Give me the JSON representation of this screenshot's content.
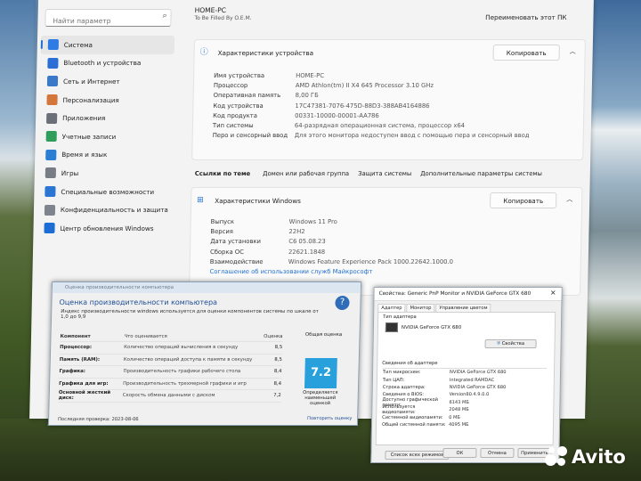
{
  "colors": {
    "accent": "#1f6fd1",
    "score": "#28a0dc",
    "wei_heading": "#1e4e94"
  },
  "sidebar": {
    "search_placeholder": "Найти параметр",
    "items": [
      {
        "label": "Система",
        "icon": "display-icon",
        "color": "#2f7be5",
        "active": true
      },
      {
        "label": "Bluetooth и устройства",
        "icon": "bluetooth-icon",
        "color": "#2b6fd6"
      },
      {
        "label": "Сеть и Интернет",
        "icon": "wifi-icon",
        "color": "#3a78c9"
      },
      {
        "label": "Персонализация",
        "icon": "brush-icon",
        "color": "#d4763c"
      },
      {
        "label": "Приложения",
        "icon": "apps-icon",
        "color": "#6b6f78"
      },
      {
        "label": "Учетные записи",
        "icon": "person-icon",
        "color": "#2f9e5b"
      },
      {
        "label": "Время и язык",
        "icon": "globe-clock-icon",
        "color": "#2a7fd4"
      },
      {
        "label": "Игры",
        "icon": "gamepad-icon",
        "color": "#777c85"
      },
      {
        "label": "Специальные возможности",
        "icon": "accessibility-icon",
        "color": "#2a76d2"
      },
      {
        "label": "Конфиденциальность и защита",
        "icon": "shield-icon",
        "color": "#7d848d"
      },
      {
        "label": "Центр обновления Windows",
        "icon": "refresh-icon",
        "color": "#1c6ed4"
      }
    ]
  },
  "header": {
    "pc_name": "HOME-PC",
    "pc_subtitle": "To Be Filled By O.E.M.",
    "rename_label": "Переименовать этот ПК"
  },
  "device_specs": {
    "title": "Характеристики устройства",
    "copy_label": "Копировать",
    "rows": [
      {
        "k": "Имя устройства",
        "v": "HOME-PC"
      },
      {
        "k": "Процессор",
        "v": "AMD Athlon(tm) II X4 645 Processor   3.10 GHz"
      },
      {
        "k": "Оперативная память",
        "v": "8,00 ГБ"
      },
      {
        "k": "Код устройства",
        "v": "17C47381-7076-475D-88D3-388AB4164886"
      },
      {
        "k": "Код продукта",
        "v": "00331-10000-00001-AA786"
      },
      {
        "k": "Тип системы",
        "v": "64-разрядная операционная система, процессор x64"
      },
      {
        "k": "Перо и сенсорный ввод",
        "v": "Для этого монитора недоступен ввод с помощью пера и сенсорный ввод"
      }
    ]
  },
  "related_links": {
    "items": [
      "Ссылки по теме",
      "Домен или рабочая группа",
      "Защита системы",
      "Дополнительные параметры системы"
    ]
  },
  "windows_specs": {
    "title": "Характеристики Windows",
    "copy_label": "Копировать",
    "rows": [
      {
        "k": "Выпуск",
        "v": "Windows 11 Pro"
      },
      {
        "k": "Версия",
        "v": "22H2"
      },
      {
        "k": "Дата установки",
        "v": "С6 05.08.23"
      },
      {
        "k": "Сборка ОС",
        "v": "22621.1848"
      },
      {
        "k": "Взаимодействие",
        "v": "Windows Feature Experience Pack 1000.22642.1000.0"
      },
      {
        "k": "Соглашение об использовании служб Майкрософт",
        "v": ""
      }
    ]
  },
  "wei": {
    "window_title": "Оценка производительности компьютера",
    "heading": "Оценка производительности компьютера",
    "description": "Индекс производительности windows используется для оценки компонентов системы по шкале от 1,0 до 9,9",
    "help": "?",
    "header": {
      "component": "Компонент",
      "rated": "Что оценивается",
      "score": "Оценка",
      "base": "Общая оценка"
    },
    "rows": [
      {
        "component": "Процессор:",
        "rated": "Количество операций вычисления в секунду",
        "score": "8,5"
      },
      {
        "component": "Память (RAM):",
        "rated": "Количество операций доступа к памяти в секунду",
        "score": "8,5"
      },
      {
        "component": "Графика:",
        "rated": "Производительность графики рабочего стола",
        "score": "8,4"
      },
      {
        "component": "Графика для игр:",
        "rated": "Производительность трехмерной графики и игр",
        "score": "8,4"
      },
      {
        "component": "Основной жесткий диск:",
        "rated": "Скорость обмена данными с диском",
        "score": "7,2"
      }
    ],
    "base_score": "7.2",
    "base_note": "Определяется наименьшей оценкой",
    "last_check": "Последняя проверка:  2023-08-06",
    "rerun": "Повторить оценку"
  },
  "display_props": {
    "title": "Свойства: Generic PnP Monitor и NVIDIA GeForce GTX 680",
    "close": "×",
    "tabs": [
      "Адаптер",
      "Монитор",
      "Управление цветом"
    ],
    "adapter_type_label": "Тип адаптера",
    "adapter_name": "NVIDIA GeForce GTX 680",
    "properties_button": "Свойства",
    "info_label": "Сведения об адаптере",
    "info_rows": [
      {
        "k": "Тип микросхем:",
        "v": "NVIDIA GeForce GTX 680"
      },
      {
        "k": "Тип ЦАП:",
        "v": "Integrated RAMDAC"
      },
      {
        "k": "Строка адаптера:",
        "v": "NVIDIA GeForce GTX 680"
      },
      {
        "k": "Сведения о BIOS:",
        "v": "Version80.4.9.0.0"
      },
      {
        "k": "Доступно графической памяти:",
        "v": "6143 МБ"
      },
      {
        "k": "Используется видеопамяти:",
        "v": "2048 МБ"
      },
      {
        "k": "Системной видеопамяти:",
        "v": "0 МБ"
      },
      {
        "k": "Общей системной памяти:",
        "v": "4095 МБ"
      }
    ],
    "list_modes_button": "Список всех режимов",
    "ok": "ОК",
    "cancel": "Отмена",
    "apply": "Применить"
  },
  "watermark": {
    "text": "Avito"
  }
}
